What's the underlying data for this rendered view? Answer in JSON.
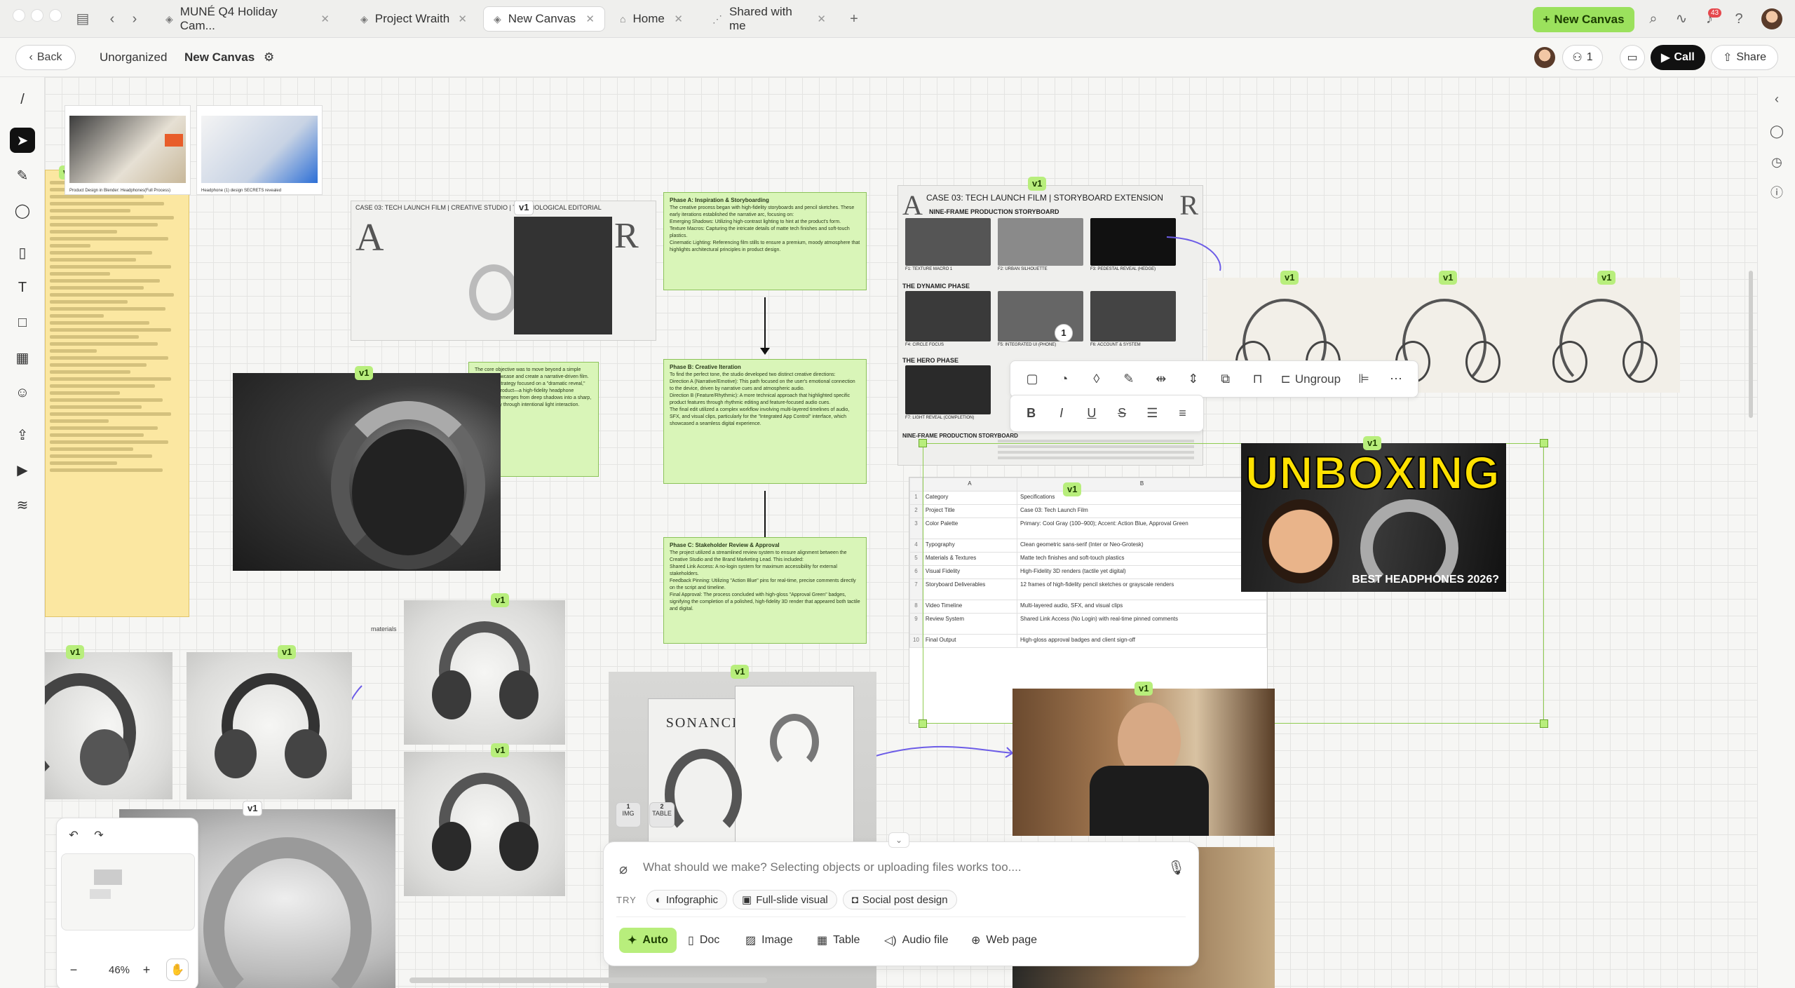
{
  "tabs": [
    {
      "label": "MUNÉ Q4 Holiday Cam...",
      "active": false
    },
    {
      "label": "Project Wraith",
      "active": false
    },
    {
      "label": "New Canvas",
      "active": true
    },
    {
      "label": "Home",
      "active": false
    },
    {
      "label": "Shared with me",
      "active": false
    }
  ],
  "topbar": {
    "new_canvas": "New Canvas",
    "notifications": "43"
  },
  "header": {
    "back": "Back",
    "crumb_folder": "Unorganized",
    "crumb_page": "New Canvas",
    "collab_count": "1",
    "call": "Call",
    "share": "Share"
  },
  "version_badge": "v1",
  "cards": {
    "yt1_caption": "Product Design in Blender: Headphones(Full Process)",
    "yt2_caption": "Headphone (1) design SECRETS revealed",
    "board1_title": "CASE 03: TECH LAUNCH FILM | CREATIVE STUDIO | TECHNOLOGICAL EDITORIAL",
    "storyboard_title": "CASE 03: TECH LAUNCH FILM | STORYBOARD EXTENSION",
    "storyboard_sub": "NINE-FRAME PRODUCTION STORYBOARD",
    "storyboard_phase2": "THE DYNAMIC PHASE",
    "storyboard_phase3": "THE HERO PHASE",
    "storyboard_footer": "NINE-FRAME PRODUCTION STORYBOARD",
    "frames": [
      "F1: TEXTURE MACRO 1",
      "F2: URBAN SILHOUETTE",
      "F3: PEDESTAL REVEAL (HEDGE)",
      "F4: CIRCLE FOCUS",
      "F5: INTEGRATED UI (PHONE)",
      "F6: ACCOUNT & SYSTEM",
      "F7: LIGHT REVEAL (COMPLETION)"
    ],
    "note_small": "The core objective was to move beyond a simple product showcase and create a narrative-driven film. The visual strategy focused on a \"dramatic reveal,\" where the product—a high-fidelity headphone wearable—emerges from deep shadows into a sharp, tactile reality through intentional light interaction.",
    "annotation": "materials"
  },
  "phases": [
    {
      "title": "Phase A: Inspiration & Storyboarding",
      "intro": "The creative process began with high-fidelity storyboards and pencil sketches. These early iterations established the narrative arc, focusing on:",
      "bullets": [
        "Emerging Shadows: Utilizing high-contrast lighting to hint at the product's form.",
        "Texture Macros: Capturing the intricate details of matte tech finishes and soft-touch plastics.",
        "Cinematic Lighting: Referencing film stills to ensure a premium, moody atmosphere that highlights architectural principles in product design."
      ]
    },
    {
      "title": "Phase B: Creative Iteration",
      "intro": "To find the perfect tone, the studio developed two distinct creative directions:",
      "bullets": [
        "Direction A (Narrative/Emotive): This path focused on the user's emotional connection to the device, driven by narrative cues and atmospheric audio.",
        "Direction B (Feature/Rhythmic): A more technical approach that highlighted specific product features through rhythmic editing and feature-focused audio cues."
      ],
      "outro": "The final edit utilized a complex workflow involving multi-layered timelines of audio, SFX, and visual clips, particularly for the \"Integrated App Control\" interface, which showcased a seamless digital experience."
    },
    {
      "title": "Phase C: Stakeholder Review & Approval",
      "intro": "The project utilized a streamlined review system to ensure alignment between the Creative Studio and the Brand Marketing Lead. This included:",
      "bullets": [
        "Shared Link Access: A no-login system for maximum accessibility for external stakeholders.",
        "Feedback Pinning: Utilizing \"Action Blue\" pins for real-time, precise comments directly on the script and timeline.",
        "Final Approval: The process concluded with high-gloss \"Approval Green\" badges, signifying the completion of a polished, high-fidelity 3D render that appeared both tactile and digital."
      ]
    }
  ],
  "spreadsheet": {
    "columns": [
      "A",
      "B"
    ],
    "rows": [
      {
        "n": "1",
        "a": "Category",
        "b": "Specifications"
      },
      {
        "n": "2",
        "a": "Project Title",
        "b": "Case 03: Tech Launch Film"
      },
      {
        "n": "3",
        "a": "Color Palette",
        "b": "Primary: Cool Gray (100–900); Accent: Action Blue, Approval Green"
      },
      {
        "n": "4",
        "a": "Typography",
        "b": "Clean geometric sans-serif (Inter or Neo-Grotesk)"
      },
      {
        "n": "5",
        "a": "Materials & Textures",
        "b": "Matte tech finishes and soft-touch plastics"
      },
      {
        "n": "6",
        "a": "Visual Fidelity",
        "b": "High-Fidelity 3D renders (tactile yet digital)"
      },
      {
        "n": "7",
        "a": "Storyboard Deliverables",
        "b": "12 frames of high-fidelity pencil sketches or grayscale renders"
      },
      {
        "n": "8",
        "a": "Video Timeline",
        "b": "Multi-layered audio, SFX, and visual clips"
      },
      {
        "n": "9",
        "a": "Review System",
        "b": "Shared Link Access (No Login) with real-time pinned comments"
      },
      {
        "n": "10",
        "a": "Final Output",
        "b": "High-gloss approval badges and client sign-off"
      }
    ]
  },
  "unboxing": {
    "title": "UNBOXING",
    "subtitle": "BEST HEADPHONES 2026?"
  },
  "box_brand": "SONANCE",
  "selection_toolbar": {
    "ungroup": "Ungroup",
    "count_badge": "1"
  },
  "minimap": {
    "zoom": "46%"
  },
  "chat": {
    "placeholder": "What should we make? Selecting objects or uploading files works too....",
    "try_label": "TRY",
    "suggestions": [
      "Infographic",
      "Full-slide visual",
      "Social post design"
    ],
    "modes": [
      "Auto",
      "Doc",
      "Image",
      "Table",
      "Audio file",
      "Web page"
    ],
    "attachments": [
      {
        "num": "1",
        "label": "IMG"
      },
      {
        "num": "2",
        "label": "TABLE"
      }
    ]
  },
  "colors": {
    "accent": "#9be15d",
    "badge": "#b8ee7c",
    "call": "#111111",
    "notification": "#e5484d"
  }
}
